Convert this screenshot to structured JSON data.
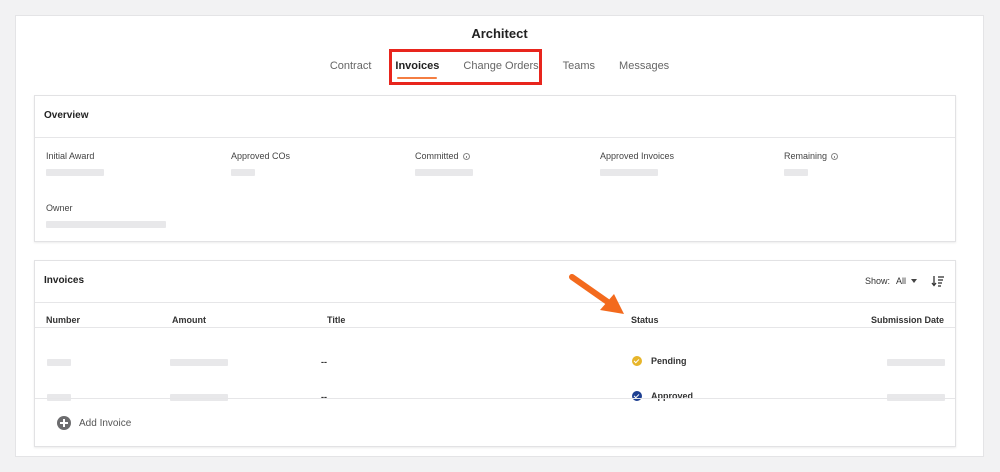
{
  "page": {
    "title": "Architect"
  },
  "tabs": [
    {
      "label": "Contract"
    },
    {
      "label": "Invoices",
      "active": true
    },
    {
      "label": "Change Orders"
    },
    {
      "label": "Teams"
    },
    {
      "label": "Messages"
    }
  ],
  "overview": {
    "title": "Overview",
    "fields": [
      {
        "label": "Initial Award"
      },
      {
        "label": "Approved COs"
      },
      {
        "label": "Committed"
      },
      {
        "label": "Approved Invoices"
      },
      {
        "label": "Remaining"
      },
      {
        "label": "Owner"
      }
    ]
  },
  "invoices": {
    "title": "Invoices",
    "show_label": "Show:",
    "show_value": "All",
    "columns": [
      "Number",
      "Amount",
      "Title",
      "Status",
      "Submission Date"
    ],
    "rows": [
      {
        "title": "--",
        "status": "Pending",
        "status_color": "#e7b52a"
      },
      {
        "title": "--",
        "status": "Approved",
        "status_color": "#1d3f91"
      }
    ],
    "add_label": "Add Invoice"
  },
  "colors": {
    "accent_tab": "#f47e42",
    "highlight_box": "#e8251d",
    "annotation_arrow": "#f36a1d"
  }
}
